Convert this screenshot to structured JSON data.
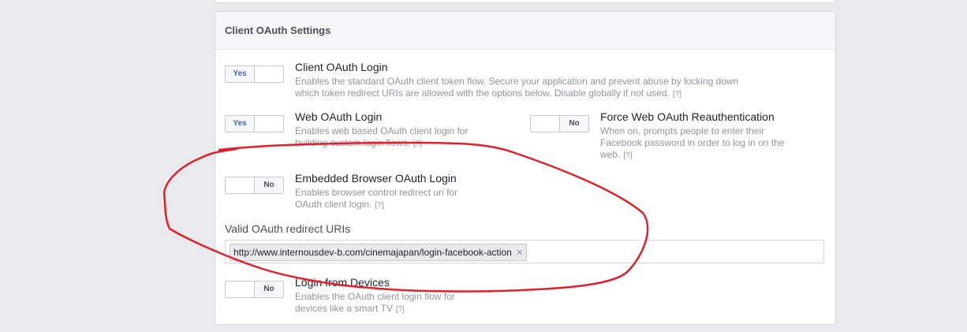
{
  "panel": {
    "title": "Client OAuth Settings"
  },
  "settings": {
    "client_oauth_login": {
      "toggle": "Yes",
      "title": "Client OAuth Login",
      "desc1": "Enables the standard OAuth client token flow. Secure your application and prevent abuse by locking down",
      "desc2": "which token redirect URIs are allowed with the options below. Disable globally if not used.",
      "help": "[?]"
    },
    "web_oauth_login": {
      "toggle": "Yes",
      "title": "Web OAuth Login",
      "desc1": "Enables web based OAuth client login for",
      "desc2": "building custom login flows.",
      "help": "[?]"
    },
    "force_web_reauth": {
      "toggle": "No",
      "title": "Force Web OAuth Reauthentication",
      "desc1": "When on, prompts people to enter their",
      "desc2": "Facebook password in order to log in on the",
      "desc3": "web.",
      "help": "[?]"
    },
    "embedded_browser": {
      "toggle": "No",
      "title": "Embedded Browser OAuth Login",
      "desc1": "Enables browser control redirect uri for",
      "desc2": "OAuth client login.",
      "help": "[?]"
    },
    "login_from_devices": {
      "toggle": "No",
      "title": "Login from Devices",
      "desc1": "Enables the OAuth client login flow for",
      "desc2": "devices like a smart TV",
      "help": "[?]"
    }
  },
  "redirect_uris": {
    "label": "Valid OAuth redirect URIs",
    "tags": [
      "http://www.internousdev-b.com/cinemajapan/login-facebook-action"
    ],
    "remove_glyph": "✕"
  },
  "colors": {
    "annotation": "#e0202a",
    "accent": "#4267b2"
  }
}
